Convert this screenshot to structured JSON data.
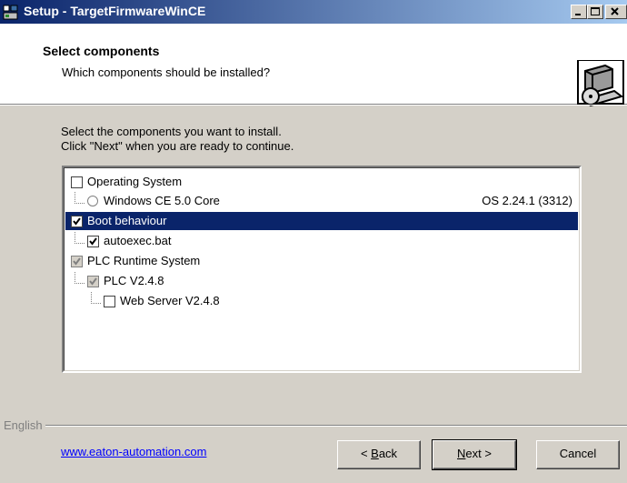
{
  "window": {
    "title": "Setup - TargetFirmwareWinCE",
    "controls": [
      "minimize",
      "maximize",
      "close"
    ]
  },
  "header": {
    "title": "Select components",
    "subtitle": "Which components should be installed?",
    "icon": "setup-computer-icon"
  },
  "instructions": {
    "line1": "Select the components you want to install.",
    "line2": "Click \"Next\" when you are ready to continue."
  },
  "components": [
    {
      "label": "Operating System",
      "control": "checkbox",
      "checked": false,
      "level": 0
    },
    {
      "label": "Windows CE 5.0 Core",
      "control": "radio",
      "checked": false,
      "level": 1,
      "extra": "OS 2.24.1 (3312)"
    },
    {
      "label": "Boot behaviour",
      "control": "checkbox",
      "checked": true,
      "level": 0,
      "selected": true
    },
    {
      "label": "autoexec.bat",
      "control": "checkbox",
      "checked": true,
      "level": 1
    },
    {
      "label": "PLC Runtime System",
      "control": "checkbox",
      "checked": true,
      "grayed": true,
      "level": 0
    },
    {
      "label": "PLC V2.4.8",
      "control": "checkbox",
      "checked": true,
      "grayed": true,
      "level": 1
    },
    {
      "label": "Web Server V2.4.8",
      "control": "checkbox",
      "checked": false,
      "level": 2
    }
  ],
  "footer": {
    "language": "English",
    "link": "www.eaton-automation.com",
    "back_pre": "< ",
    "back_mnemonic": "B",
    "back_post": "ack",
    "next_mnemonic": "N",
    "next_post": "ext >",
    "cancel": "Cancel"
  }
}
